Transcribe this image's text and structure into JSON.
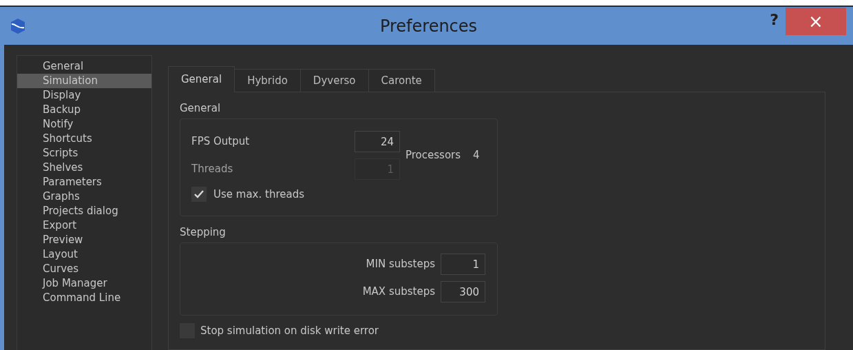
{
  "window": {
    "title": "Preferences",
    "help": "?",
    "close": "×"
  },
  "sidebar": {
    "items": [
      {
        "label": "General",
        "selected": false
      },
      {
        "label": "Simulation",
        "selected": true
      },
      {
        "label": "Display",
        "selected": false
      },
      {
        "label": "Backup",
        "selected": false
      },
      {
        "label": "Notify",
        "selected": false
      },
      {
        "label": "Shortcuts",
        "selected": false
      },
      {
        "label": "Scripts",
        "selected": false
      },
      {
        "label": "Shelves",
        "selected": false
      },
      {
        "label": "Parameters",
        "selected": false
      },
      {
        "label": "Graphs",
        "selected": false
      },
      {
        "label": "Projects dialog",
        "selected": false
      },
      {
        "label": "Export",
        "selected": false
      },
      {
        "label": "Preview",
        "selected": false
      },
      {
        "label": "Layout",
        "selected": false
      },
      {
        "label": "Curves",
        "selected": false
      },
      {
        "label": "Job Manager",
        "selected": false
      },
      {
        "label": "Command Line",
        "selected": false
      }
    ]
  },
  "tabs": [
    {
      "label": "General",
      "selected": true
    },
    {
      "label": "Hybrido",
      "selected": false
    },
    {
      "label": "Dyverso",
      "selected": false
    },
    {
      "label": "Caronte",
      "selected": false
    }
  ],
  "general": {
    "title": "General",
    "fps": {
      "label": "FPS Output",
      "value": "24",
      "disabled": false
    },
    "threads": {
      "label": "Threads",
      "value": "1",
      "disabled": true
    },
    "processors": {
      "label": "Processors",
      "value": "4"
    },
    "use_max_threads": {
      "label": "Use max. threads",
      "checked": true
    }
  },
  "stepping": {
    "title": "Stepping",
    "fields": [
      {
        "label": "MIN substeps",
        "value": "1"
      },
      {
        "label": "MAX substeps",
        "value": "300"
      }
    ]
  },
  "stop_on_error": {
    "label": "Stop simulation on disk write error",
    "checked": false
  }
}
